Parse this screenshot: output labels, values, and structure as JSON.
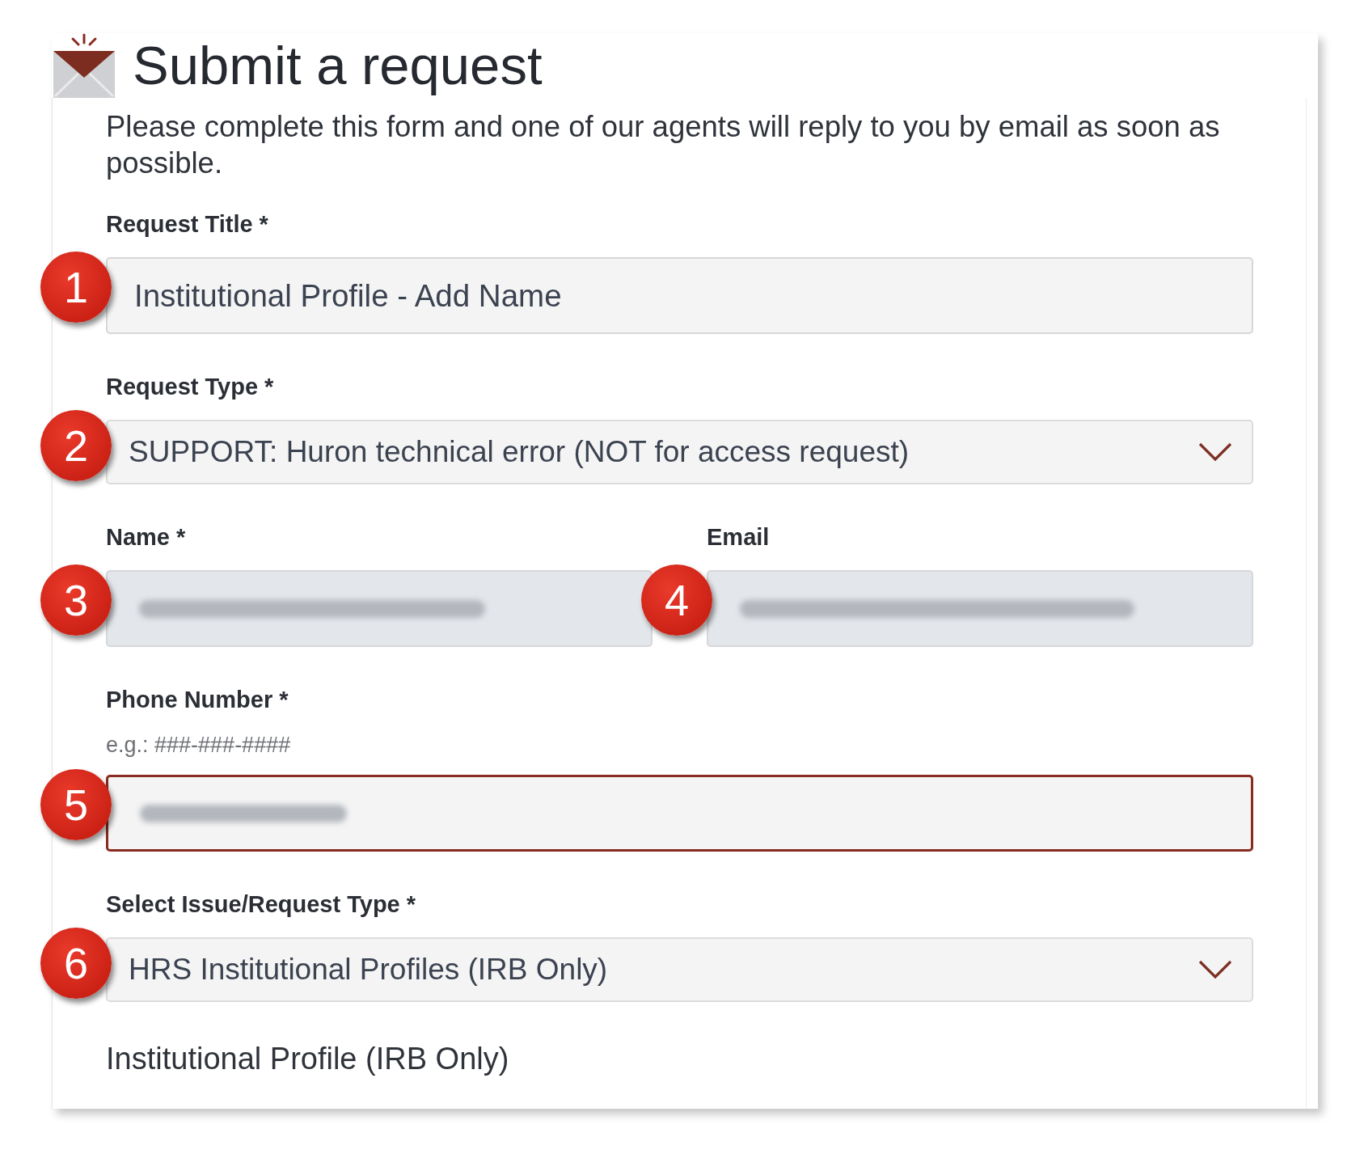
{
  "header": {
    "title": "Submit a request"
  },
  "intro": "Please complete this form and one of our agents will reply to you by email as soon as possible.",
  "rows": [
    {
      "fields": [
        {
          "kind": "text",
          "label": "Request Title *",
          "value": "Institutional Profile - Add Name",
          "callout": "1",
          "disabled": false,
          "focused": false,
          "redacted": false
        }
      ]
    },
    {
      "fields": [
        {
          "kind": "select",
          "label": "Request Type *",
          "value": "SUPPORT: Huron technical error (NOT for access request)",
          "callout": "2",
          "disabled": false,
          "focused": false
        }
      ]
    },
    {
      "fields": [
        {
          "kind": "text",
          "label": "Name *",
          "callout": "3",
          "disabled": true,
          "focused": false,
          "redacted": true
        },
        {
          "kind": "text",
          "label": "Email",
          "callout": "4",
          "disabled": true,
          "focused": false,
          "redacted": true
        }
      ]
    },
    {
      "fields": [
        {
          "kind": "text",
          "label": "Phone Number *",
          "hint": "e.g.: ###-###-####",
          "callout": "5",
          "disabled": false,
          "focused": true,
          "redacted": true
        }
      ]
    },
    {
      "fields": [
        {
          "kind": "select",
          "label": "Select Issue/Request Type *",
          "value": "HRS Institutional Profiles (IRB Only)",
          "callout": "6",
          "disabled": false,
          "focused": false
        }
      ]
    }
  ],
  "note": "Institutional Profile (IRB Only)"
}
